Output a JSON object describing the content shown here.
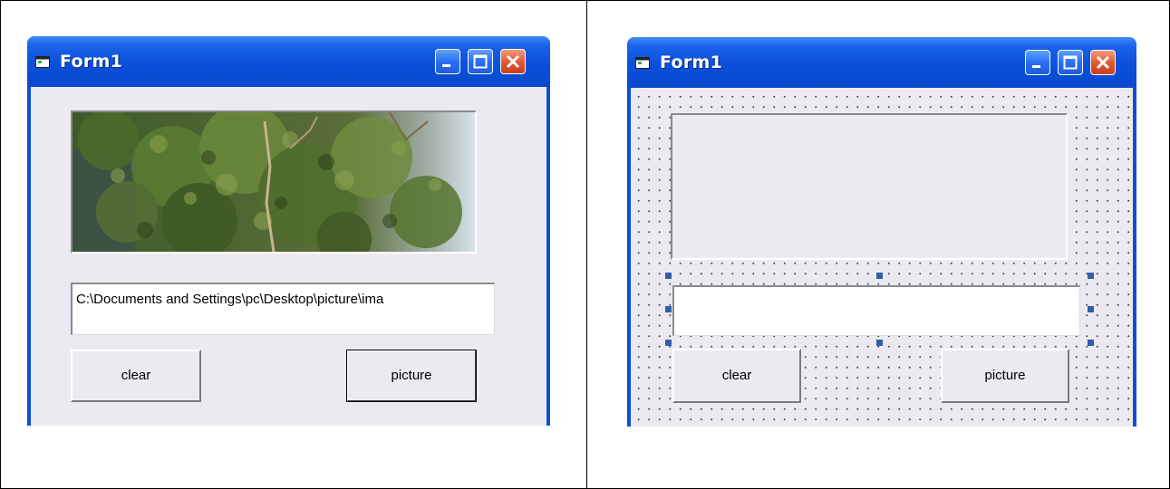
{
  "left_window": {
    "title": "Form1",
    "textbox_value": "C:\\Documents and Settings\\pc\\Desktop\\picture\\ima",
    "clear_label": "clear",
    "picture_label": "picture",
    "picturebox_content": "tree-photo"
  },
  "right_window": {
    "title": "Form1",
    "textbox_value": "",
    "clear_label": "clear",
    "picture_label": "picture",
    "mode": "design"
  },
  "colors": {
    "titlebar": "#0b4fdb",
    "client": "#ece9f0",
    "close_button": "#e0552f",
    "selection_handle": "#2f5fa8"
  },
  "icons": [
    "form-icon",
    "minimize-icon",
    "maximize-icon",
    "close-icon"
  ]
}
